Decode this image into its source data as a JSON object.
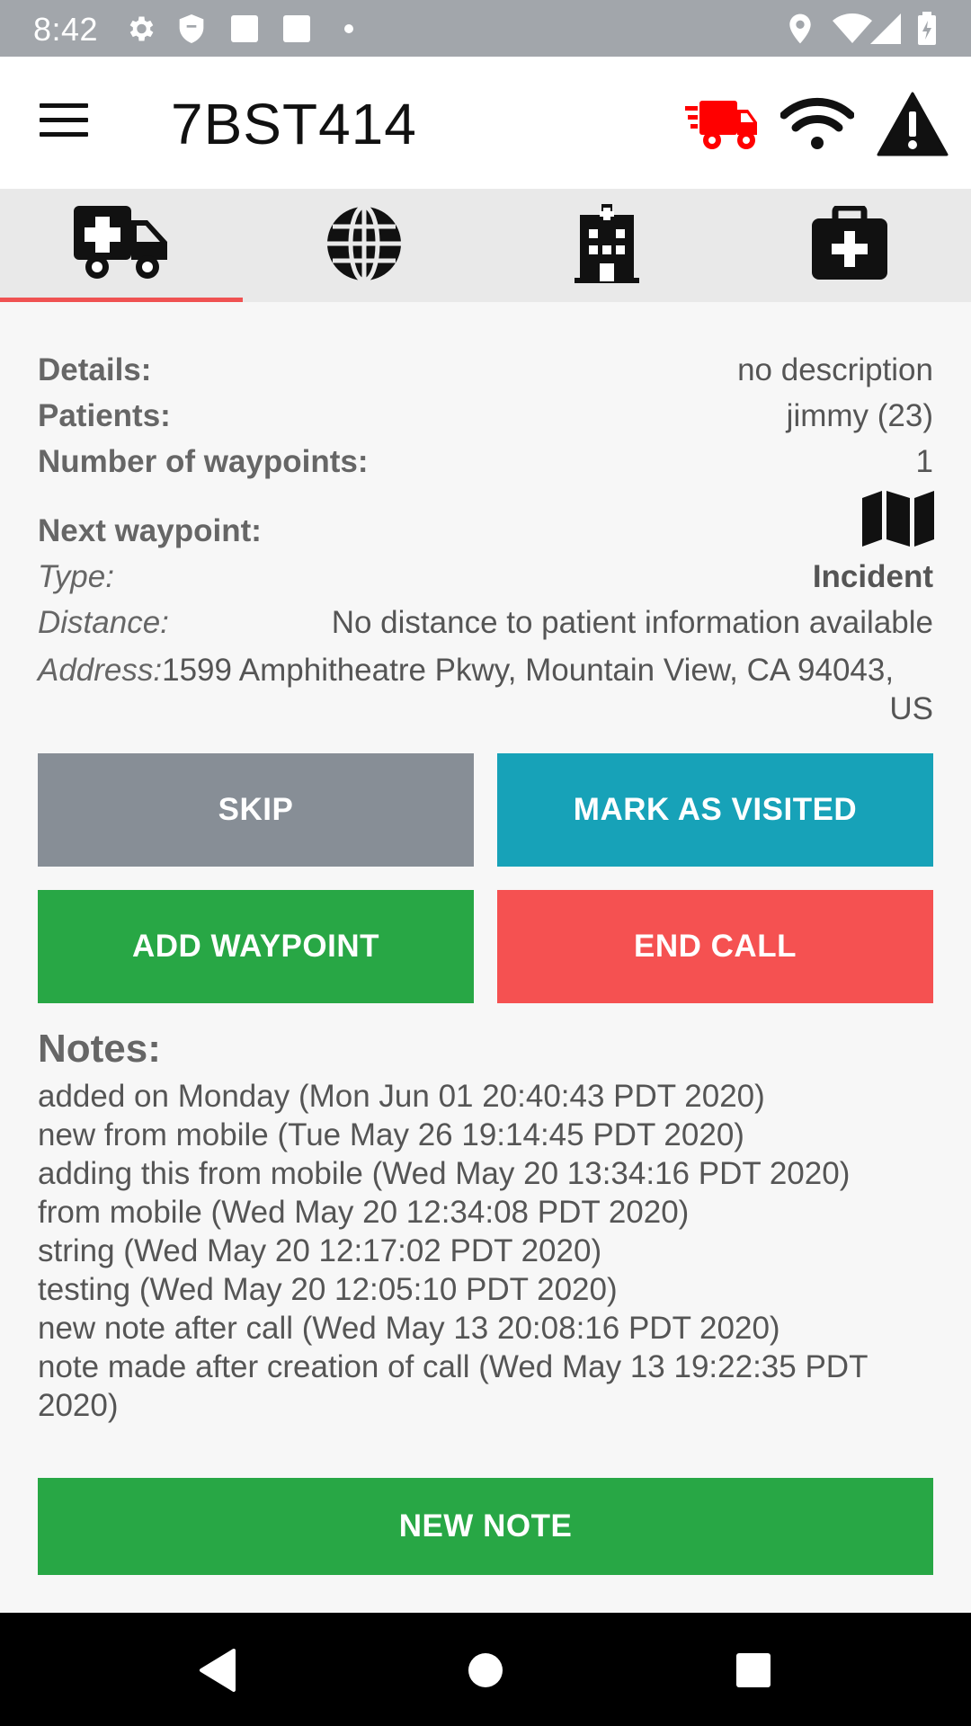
{
  "status_bar": {
    "time": "8:42",
    "icons": [
      "gear-icon",
      "shield-icon",
      "square-icon",
      "square-icon",
      "dot-icon",
      "location-pin-icon",
      "wifi-icon",
      "signal-icon",
      "battery-icon"
    ]
  },
  "app_bar": {
    "title": "7BST414",
    "icons": [
      "menu-icon",
      "truck-fast-icon",
      "wifi-icon",
      "warning-icon"
    ],
    "colors": {
      "truck": "#ff0000"
    }
  },
  "tabs": [
    {
      "name": "ambulance",
      "icon": "ambulance-icon",
      "active": true
    },
    {
      "name": "globe",
      "icon": "globe-icon",
      "active": false
    },
    {
      "name": "hospital",
      "icon": "hospital-icon",
      "active": false
    },
    {
      "name": "medkit",
      "icon": "medkit-icon",
      "active": false
    }
  ],
  "details": {
    "details_label": "Details:",
    "details_value": "no description",
    "patients_label": "Patients:",
    "patients_value": "jimmy (23)",
    "waypoints_label": "Number of waypoints:",
    "waypoints_value": "1",
    "next_waypoint_label": "Next waypoint:",
    "type_label": "Type:",
    "type_value": "Incident",
    "distance_label": "Distance:",
    "distance_value": "No distance to patient information available",
    "address_label": "Address:",
    "address_value_line1": "1599 Amphitheatre Pkwy, Mountain View, CA 94043,",
    "address_value_line2": "US"
  },
  "buttons": {
    "skip": "SKIP",
    "mark_visited": "MARK AS VISITED",
    "add_waypoint": "ADD WAYPOINT",
    "end_call": "END CALL",
    "new_note": "NEW NOTE"
  },
  "button_colors": {
    "skip": "#878e96",
    "mark_visited": "#17a2b8",
    "add_waypoint": "#28a745",
    "end_call": "#f55151",
    "new_note": "#28a745"
  },
  "notes": {
    "title": "Notes:",
    "items": [
      "added on Monday (Mon Jun 01 20:40:43 PDT 2020)",
      "new from mobile (Tue May 26 19:14:45 PDT 2020)",
      "adding this from mobile (Wed May 20 13:34:16 PDT 2020)",
      "from mobile (Wed May 20 12:34:08 PDT 2020)",
      "string (Wed May 20 12:17:02 PDT 2020)",
      "testing (Wed May 20 12:05:10 PDT 2020)",
      "new note after call (Wed May 13 20:08:16 PDT 2020)",
      "note made after creation of call (Wed May 13 19:22:35 PDT 2020)"
    ]
  },
  "nav_bar": {
    "icons": [
      "back-icon",
      "home-icon",
      "recents-icon"
    ]
  }
}
